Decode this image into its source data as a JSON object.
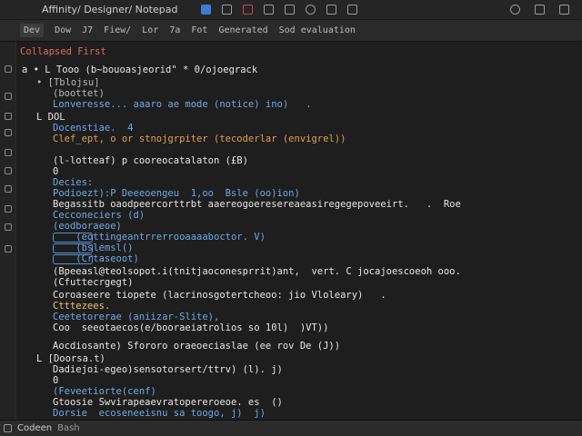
{
  "window": {
    "title": "Affinity/ Designer/ Notepad"
  },
  "toolbar": {
    "items": [
      "Dev",
      "Dow",
      "J7",
      "Fiew/",
      "Lor",
      "7a",
      "Fot",
      "Generated",
      "Sod evaluation"
    ]
  },
  "editor": {
    "header": "Collapsed First",
    "lines": [
      {
        "text": "a • L Tooo (b~bouoasjeorid\" * 0/ojoegrack",
        "color": "white"
      },
      {
        "text": "• [Tblojsu]",
        "color": "gray"
      },
      {
        "text": "(boottet)",
        "color": "gray"
      },
      {
        "text": "Lonveresse... aaaro ae mode (notice) ino)   .",
        "color": "blue"
      },
      {
        "text": "L DOL",
        "color": "white"
      },
      {
        "text": "Docenstiae.  4",
        "color": "blue"
      },
      {
        "text": "Clef_ept, o or stnojgrpiter (tecoderlar (envigrel))",
        "color": "orange"
      },
      {
        "text": "(l-lotteaf) p cooreocatalaton (£B)",
        "color": "white"
      },
      {
        "text": "0",
        "color": "white"
      },
      {
        "text": "Decies:",
        "color": "blue"
      },
      {
        "text": "Podioezt):P Deeeoengeu  1,oo  Bsle (oo)ion)",
        "color": "blue"
      },
      {
        "text": "Begassitb oaodpeercorttrbt aaereogoeresereaeasiregegepoveeirt.   .  Roe",
        "color": "white"
      },
      {
        "text": "Cecconeciers (d)",
        "color": "blue"
      },
      {
        "text": "(eodboraeoe)",
        "color": "blue"
      },
      {
        "text": "    (eottingeantrrerrooaaaaboctor. V)",
        "color": "blue"
      },
      {
        "text": "    (bslemsl()",
        "color": "blue"
      },
      {
        "text": "    (Crtaseoot)",
        "color": "blue"
      },
      {
        "text": "(Bpeeasl@teolsopot.i(tnitjaoconesprrit)ant,  vert. C jocajoescoeoh ooo.",
        "color": "white"
      },
      {
        "text": "(Cfuttecrgegt)",
        "color": "white"
      },
      {
        "text": "Coroaseere tiopete (lacrinosgotertcheoo: jio Vloleary)   .",
        "color": "white"
      },
      {
        "text": "Ctttezees.",
        "color": "yellow"
      },
      {
        "text": "Ceetetorerae (aniizar-Slite),",
        "color": "blue"
      },
      {
        "text": "Coo  seeotaecos(e/booraeiatrolios so 10l)  )VT))",
        "color": "white"
      },
      {
        "text": "Aocdiosante) Sfororo oraeoeciaslae (ee rov De (J))",
        "color": "white"
      },
      {
        "text": "L [Doorsa.t)",
        "color": "white"
      },
      {
        "text": "Dadiejoi-egeo)sensotorsert/ttrv) (l). j)",
        "color": "white"
      },
      {
        "text": "0",
        "color": "white"
      },
      {
        "text": "(Feveetiorte(cenf)",
        "color": "blue"
      },
      {
        "text": "Gtoosie Swvirapeaevratopereroeoe. es  ()",
        "color": "white"
      },
      {
        "text": "Dorsie  ecoseneeisnu sa toogo, j)  j)",
        "color": "blue"
      }
    ]
  },
  "status": {
    "left": "Codeen",
    "mode": "Bash"
  }
}
